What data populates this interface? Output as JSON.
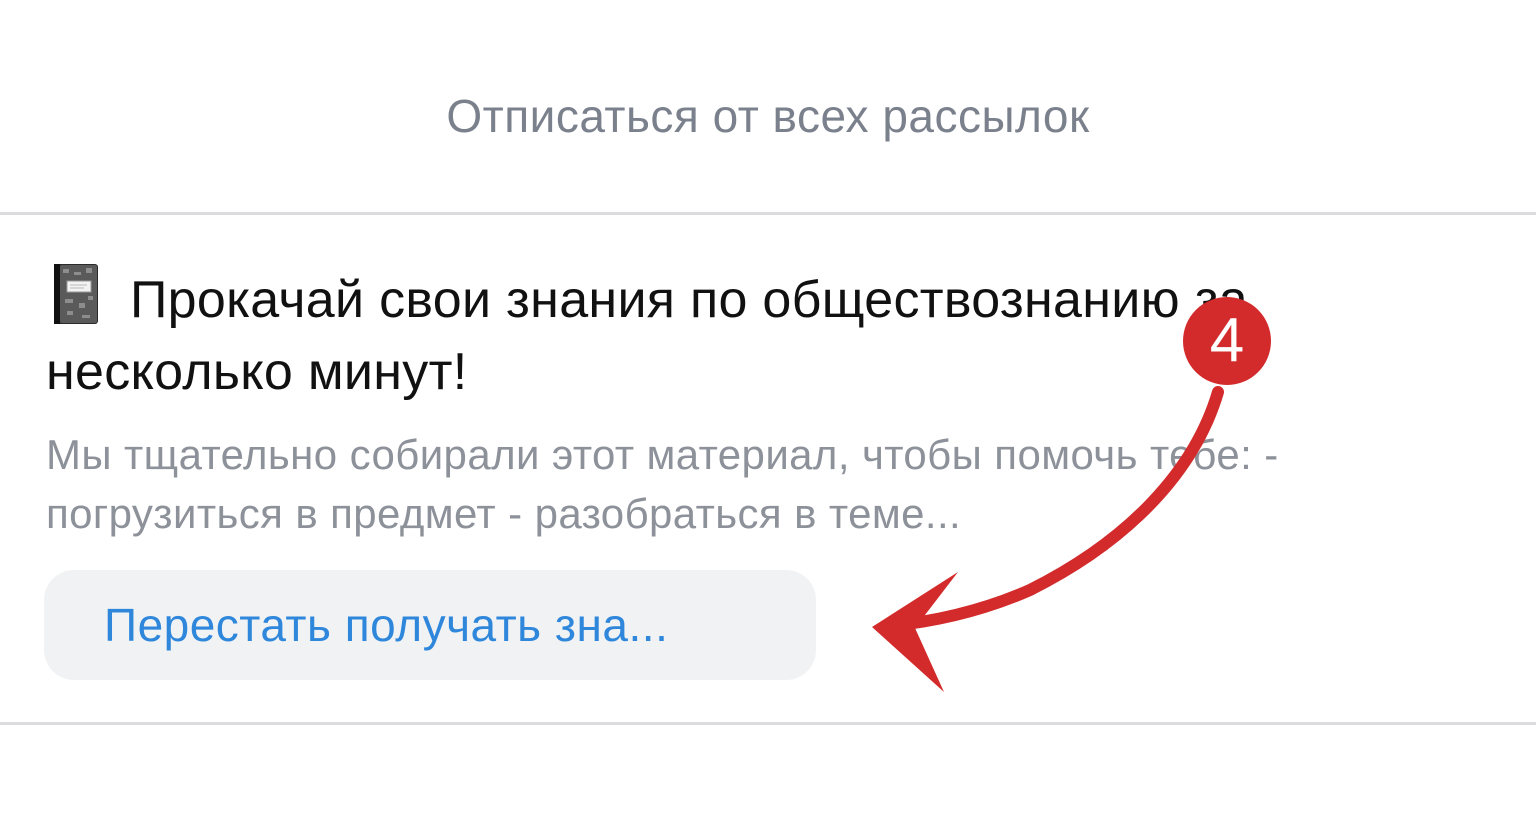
{
  "header": {
    "unsubscribe_all_label": "Отписаться от всех рассылок"
  },
  "newsletter": {
    "icon": "notebook-icon",
    "title": "Прокачай свои знания по обществознанию за несколько минут!",
    "description": "Мы тщательно собирали этот материал, чтобы помочь тебе: - погрузиться в предмет - разобраться в теме...",
    "stop_button_label": "Перестать получать зна..."
  },
  "annotation": {
    "step_number": "4",
    "color": "#d32b2b"
  },
  "colors": {
    "link_blue": "#2f87dc",
    "muted_text": "#8d9199",
    "button_bg": "#f1f2f4",
    "divider": "#dcdcdf"
  }
}
